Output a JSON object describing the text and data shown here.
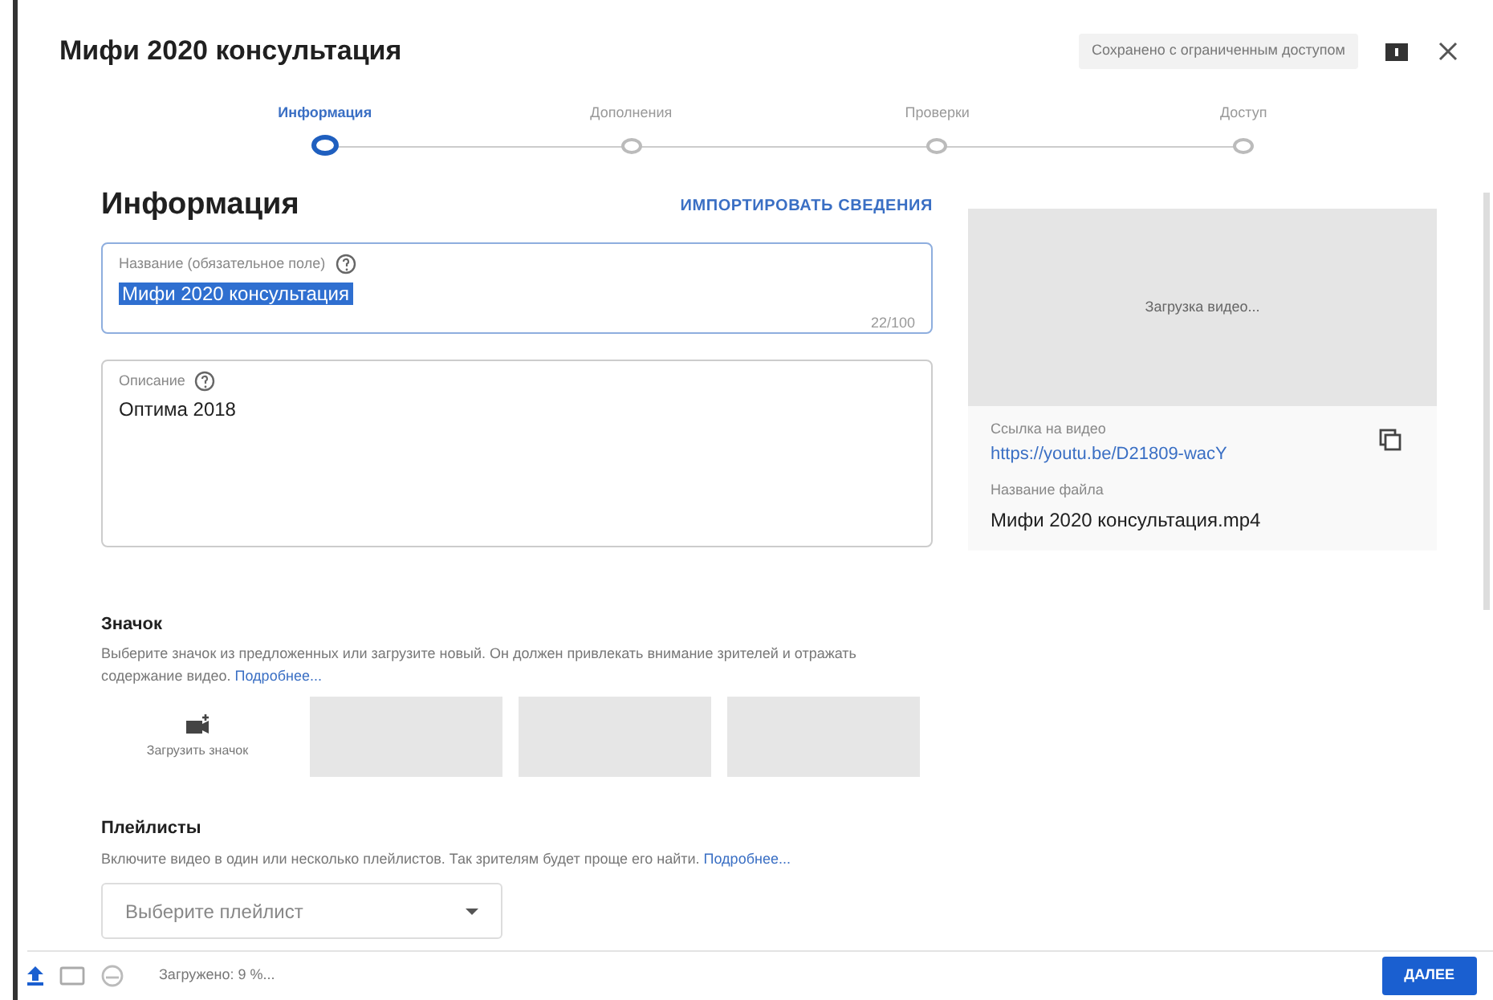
{
  "dialog": {
    "title": "Мифи 2020 консультация",
    "save_status": "Сохранено с ограниченным доступом"
  },
  "steps": [
    {
      "label": "Информация",
      "selected": true
    },
    {
      "label": "Дополнения",
      "selected": false
    },
    {
      "label": "Проверки",
      "selected": false
    },
    {
      "label": "Доступ",
      "selected": false
    }
  ],
  "details": {
    "heading": "Информация",
    "import_link": "ИМПОРТИРОВАТЬ СВЕДЕНИЯ",
    "title_field": {
      "label": "Название (обязательное поле)",
      "value": "Мифи 2020 консультация",
      "text_selected": true,
      "counter": "22/100"
    },
    "description_field": {
      "label": "Описание",
      "value": "Оптима 2018"
    }
  },
  "thumbnail": {
    "heading": "Значок",
    "text": "Выберите значок из предложенных или загрузите новый. Он должен привлекать внимание зрителей и отражать содержание видео.",
    "more_link": "Подробнее...",
    "upload_label": "Загрузить значок",
    "options": [
      {
        "kind": "placeholder"
      },
      {
        "kind": "placeholder"
      },
      {
        "kind": "placeholder"
      }
    ]
  },
  "playlists": {
    "heading": "Плейлисты",
    "text": "Включите видео в один или несколько плейлистов. Так зрителям будет проще его найти.",
    "more_link": "Подробнее...",
    "select_placeholder": "Выберите плейлист"
  },
  "preview": {
    "status": "Загрузка видео...",
    "link_label": "Ссылка на видео",
    "link": "https://youtu.be/D21809-wacY",
    "file_label": "Название файла",
    "file_name": "Мифи 2020 консультация.mp4"
  },
  "footer": {
    "progress": "Загружено: 9 %...",
    "next_button": "ДАЛЕЕ"
  }
}
